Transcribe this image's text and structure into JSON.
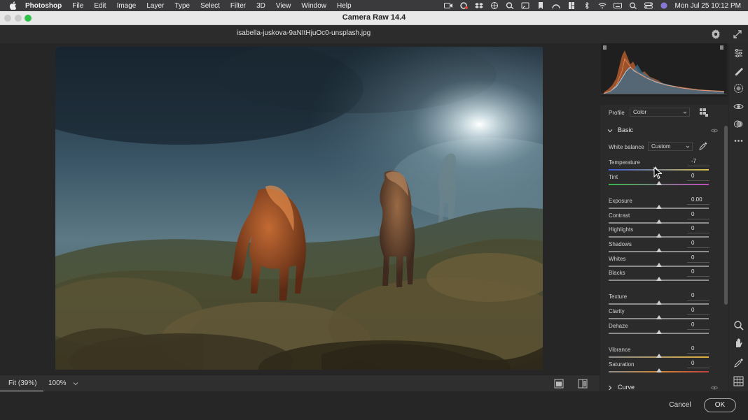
{
  "menubar": {
    "app": "Photoshop",
    "items": [
      "File",
      "Edit",
      "Image",
      "Layer",
      "Type",
      "Select",
      "Filter",
      "3D",
      "View",
      "Window",
      "Help"
    ],
    "clock": "Mon Jul 25  10:12 PM"
  },
  "window": {
    "title": "Camera Raw 14.4"
  },
  "file": {
    "name": "isabella-juskova-9aNItHjuOc0-unsplash.jpg"
  },
  "bottom": {
    "fit_label": "Fit (39%)",
    "zoom_value": "100%"
  },
  "footer": {
    "cancel_label": "Cancel",
    "ok_label": "OK"
  },
  "panel": {
    "profile_label": "Profile",
    "profile_value": "Color",
    "basic": {
      "title": "Basic",
      "white_balance_label": "White balance",
      "white_balance_value": "Custom",
      "sliders": [
        {
          "name": "Temperature",
          "value": "-7",
          "position": 0.47
        },
        {
          "name": "Tint",
          "value": "0",
          "position": 0.5
        },
        {
          "name": "Exposure",
          "value": "0.00",
          "position": 0.5
        },
        {
          "name": "Contrast",
          "value": "0",
          "position": 0.5
        },
        {
          "name": "Highlights",
          "value": "0",
          "position": 0.5
        },
        {
          "name": "Shadows",
          "value": "0",
          "position": 0.5
        },
        {
          "name": "Whites",
          "value": "0",
          "position": 0.5
        },
        {
          "name": "Blacks",
          "value": "0",
          "position": 0.5
        },
        {
          "name": "Texture",
          "value": "0",
          "position": 0.5
        },
        {
          "name": "Clarity",
          "value": "0",
          "position": 0.5
        },
        {
          "name": "Dehaze",
          "value": "0",
          "position": 0.5
        },
        {
          "name": "Vibrance",
          "value": "0",
          "position": 0.5
        },
        {
          "name": "Saturation",
          "value": "0",
          "position": 0.5
        }
      ]
    },
    "curve": {
      "title": "Curve"
    }
  },
  "colors": {
    "accent_green": "#2fc147",
    "panel_bg": "#2b2b2b"
  }
}
